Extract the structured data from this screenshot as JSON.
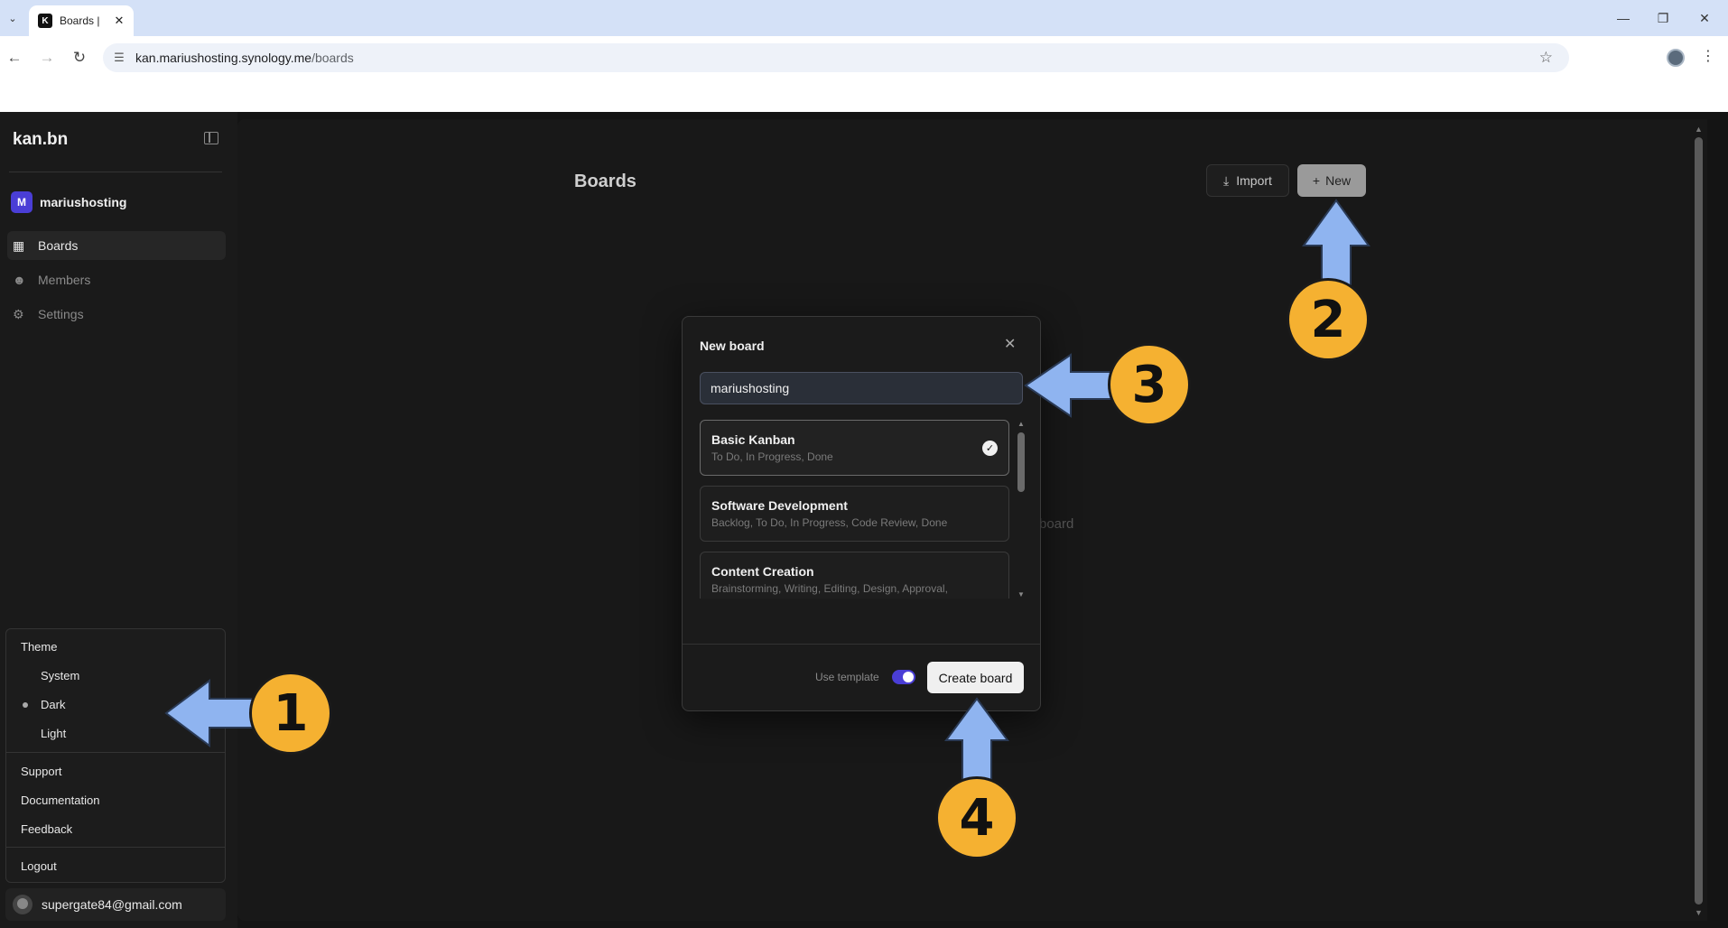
{
  "browser": {
    "tab_title": "Boards |",
    "favicon_letter": "K",
    "url_host": "kan.mariushosting.synology.me",
    "url_path": "/boards"
  },
  "sidebar": {
    "logo": "kan.bn",
    "workspace_initial": "M",
    "workspace_name": "mariushosting",
    "nav": [
      {
        "label": "Boards"
      },
      {
        "label": "Members"
      },
      {
        "label": "Settings"
      }
    ],
    "menu": {
      "theme_label": "Theme",
      "theme_options": [
        "System",
        "Dark",
        "Light"
      ],
      "selected_theme": "Dark",
      "links": [
        "Support",
        "Documentation",
        "Feedback"
      ],
      "logout": "Logout"
    },
    "user_email": "supergate84@gmail.com"
  },
  "main": {
    "title": "Boards",
    "import_label": "Import",
    "new_label": "New",
    "empty_fragment": "board"
  },
  "modal": {
    "title": "New board",
    "name_value": "mariushosting",
    "templates": [
      {
        "name": "Basic Kanban",
        "desc": "To Do, In Progress, Done",
        "selected": true
      },
      {
        "name": "Software Development",
        "desc": "Backlog, To Do, In Progress, Code Review, Done",
        "selected": false
      },
      {
        "name": "Content Creation",
        "desc": "Brainstorming, Writing, Editing, Design, Approval,",
        "selected": false
      }
    ],
    "use_template_label": "Use template",
    "use_template_on": true,
    "create_label": "Create board"
  },
  "annotations": {
    "callouts": [
      "1",
      "2",
      "3",
      "4"
    ],
    "color": "#f5b131",
    "arrow_color": "#8fb4f0"
  }
}
